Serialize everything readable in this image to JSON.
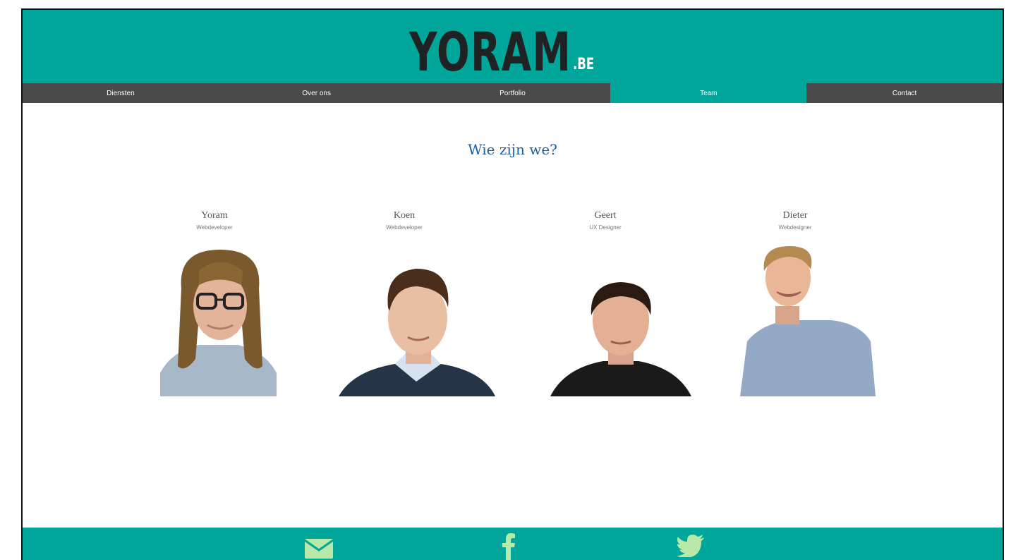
{
  "site": {
    "logo_main": "YORAM",
    "logo_tld": ".BE"
  },
  "nav": {
    "items": [
      {
        "label": "Diensten"
      },
      {
        "label": "Over ons"
      },
      {
        "label": "Portfolio"
      },
      {
        "label": "Team"
      },
      {
        "label": "Contact"
      }
    ],
    "active": "Team"
  },
  "main": {
    "heading": "Wie zijn we?",
    "members": [
      {
        "name": "Yoram",
        "role": "Webdeveloper"
      },
      {
        "name": "Koen",
        "role": "Webdeveloper"
      },
      {
        "name": "Geert",
        "role": "UX Designer"
      },
      {
        "name": "Dieter",
        "role": "Webdesigner"
      }
    ]
  },
  "footer": {
    "icons": [
      "envelope-icon",
      "facebook-icon",
      "twitter-icon"
    ]
  },
  "colors": {
    "brand": "#00a699",
    "nav_bg": "#4a4a4a",
    "heading": "#1a5fa0"
  }
}
